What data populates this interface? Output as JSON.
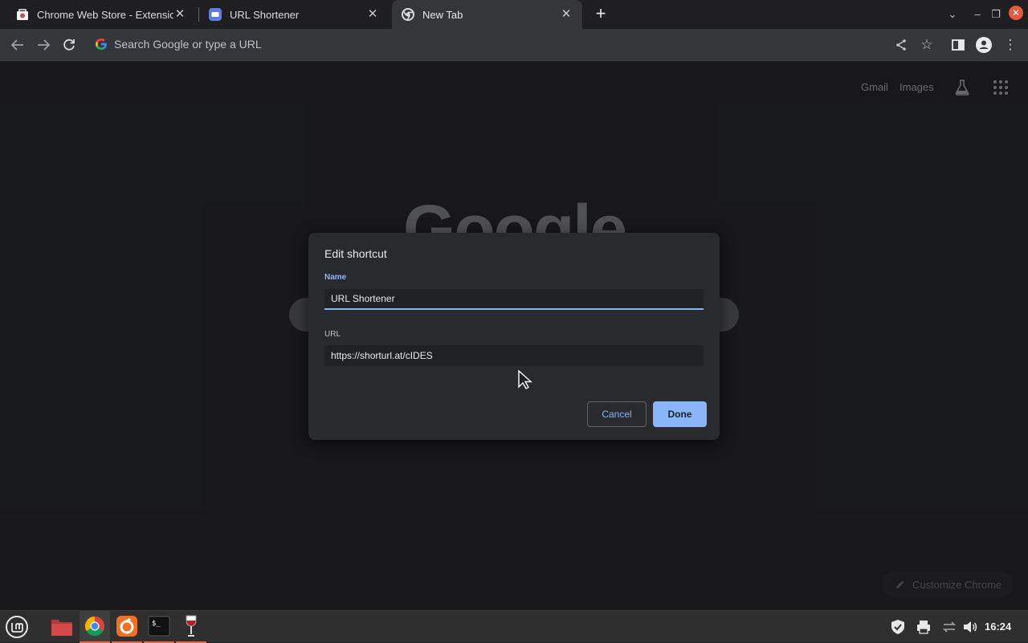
{
  "tabs": [
    {
      "title": "Chrome Web Store - Extensio",
      "favicon": "chrome-web-store-icon",
      "active": false
    },
    {
      "title": "URL Shortener",
      "favicon": "url-shortener-icon",
      "active": false
    },
    {
      "title": "New Tab",
      "favicon": "chrome-icon",
      "active": true
    }
  ],
  "omnibox": {
    "placeholder": "Search Google or type a URL"
  },
  "ntp": {
    "links": {
      "gmail": "Gmail",
      "images": "Images"
    },
    "logo": "Google",
    "customize_label": "Customize Chrome"
  },
  "dialog": {
    "title": "Edit shortcut",
    "name_label": "Name",
    "name_value": "URL Shortener",
    "url_label": "URL",
    "url_value": "https://shorturl.at/cIDES",
    "cancel_label": "Cancel",
    "done_label": "Done"
  },
  "taskbar": {
    "apps": [
      "mint-menu-icon",
      "files-icon",
      "chrome-icon",
      "firefox-icon",
      "terminal-icon",
      "wine-icon"
    ],
    "clock": "16:24"
  },
  "colors": {
    "accent": "#8ab4f8",
    "background": "#202124",
    "dialog": "#292a2d"
  }
}
